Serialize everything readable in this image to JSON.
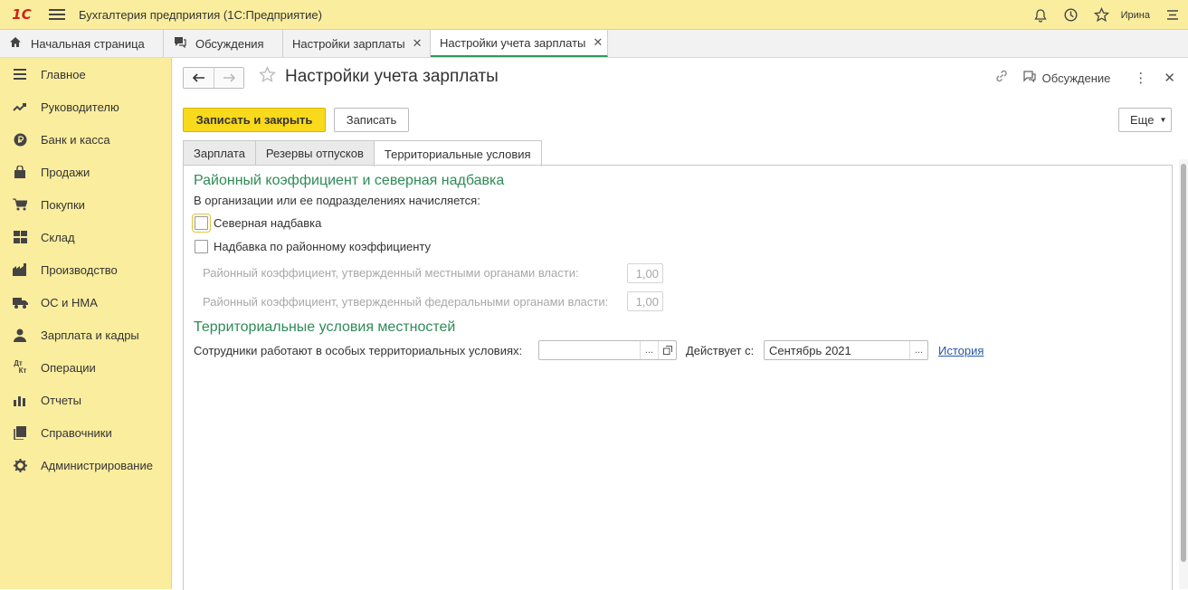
{
  "app": {
    "logo": "1С",
    "title": "Бухгалтерия предприятия (1С:Предприятие)",
    "user": "Ирина"
  },
  "window_tabs": [
    {
      "label": "Начальная страница",
      "icon": "home-icon"
    },
    {
      "label": "Обсуждения",
      "icon": "chat-icon"
    },
    {
      "label": "Настройки зарплаты",
      "closable": true
    },
    {
      "label": "Настройки учета зарплаты",
      "closable": true,
      "active": true
    }
  ],
  "sidebar": {
    "items": [
      {
        "label": "Главное",
        "icon": "list-icon"
      },
      {
        "label": "Руководителю",
        "icon": "trend-icon"
      },
      {
        "label": "Банк и касса",
        "icon": "ruble-icon"
      },
      {
        "label": "Продажи",
        "icon": "bag-icon"
      },
      {
        "label": "Покупки",
        "icon": "cart-icon"
      },
      {
        "label": "Склад",
        "icon": "warehouse-icon"
      },
      {
        "label": "Производство",
        "icon": "factory-icon"
      },
      {
        "label": "ОС и НМА",
        "icon": "truck-icon"
      },
      {
        "label": "Зарплата и кадры",
        "icon": "person-icon"
      },
      {
        "label": "Операции",
        "icon": "dt-kt-icon"
      },
      {
        "label": "Отчеты",
        "icon": "bar-chart-icon"
      },
      {
        "label": "Справочники",
        "icon": "books-icon"
      },
      {
        "label": "Администрирование",
        "icon": "gear-icon"
      }
    ]
  },
  "form": {
    "title": "Настройки учета зарплаты",
    "discussion_label": "Обсуждение",
    "save_close_label": "Записать и закрыть",
    "save_label": "Записать",
    "more_label": "Еще",
    "tabs": [
      "Зарплата",
      "Резервы отпусков",
      "Территориальные условия"
    ],
    "section1": {
      "title": "Районный коэффициент и северная надбавка",
      "subtitle": "В организации или ее подразделениях начисляется:",
      "north_bonus_label": "Северная надбавка",
      "north_bonus_checked": false,
      "regional_bonus_label": "Надбавка по районному коэффициенту",
      "regional_bonus_checked": false,
      "local_coef_label": "Районный коэффициент, утвержденный местными органами власти:",
      "local_coef_value": "1,00",
      "federal_coef_label": "Районный коэффициент, утвержденный федеральными органами власти:",
      "federal_coef_value": "1,00"
    },
    "section2": {
      "title": "Территориальные условия местностей",
      "conditions_label": "Сотрудники работают в особых территориальных условиях:",
      "conditions_value": "",
      "effective_label": "Действует с:",
      "effective_value": "Сентябрь 2021",
      "history_link": "История"
    }
  }
}
